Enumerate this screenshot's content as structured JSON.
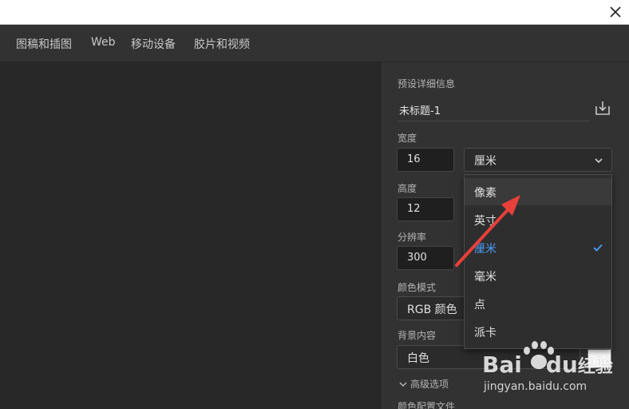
{
  "tabs": [
    {
      "label": "图稿和插图"
    },
    {
      "label": "Web"
    },
    {
      "label": "移动设备"
    },
    {
      "label": "胶片和视频"
    }
  ],
  "panel": {
    "preset_heading": "预设详细信息",
    "preset_name": "未标题-1",
    "width_label": "宽度",
    "width_value": "16",
    "unit_selected": "厘米",
    "height_label": "高度",
    "height_value": "12",
    "resolution_label": "分辨率",
    "resolution_value": "300",
    "color_mode_label": "颜色模式",
    "color_mode_value": "RGB 颜色",
    "background_label": "背景内容",
    "background_value": "白色",
    "background_swatch_color": "#ffffff",
    "advanced_label": "高级选项",
    "color_profile_label": "颜色配置文件"
  },
  "unit_dropdown": {
    "options": [
      {
        "label": "像素",
        "state": "hover"
      },
      {
        "label": "英寸",
        "state": "normal"
      },
      {
        "label": "厘米",
        "state": "selected"
      },
      {
        "label": "毫米",
        "state": "normal"
      },
      {
        "label": "点",
        "state": "normal"
      },
      {
        "label": "派卡",
        "state": "normal"
      }
    ]
  },
  "watermark": {
    "brand_latin": "Bai",
    "brand_latin_2": "du",
    "brand_cn": "经验",
    "url": "jingyan.baidu.com"
  },
  "colors": {
    "accent": "#4a9eff",
    "annotation_arrow": "#e8403a",
    "panel_bg": "#323232",
    "canvas_bg": "#282828"
  }
}
